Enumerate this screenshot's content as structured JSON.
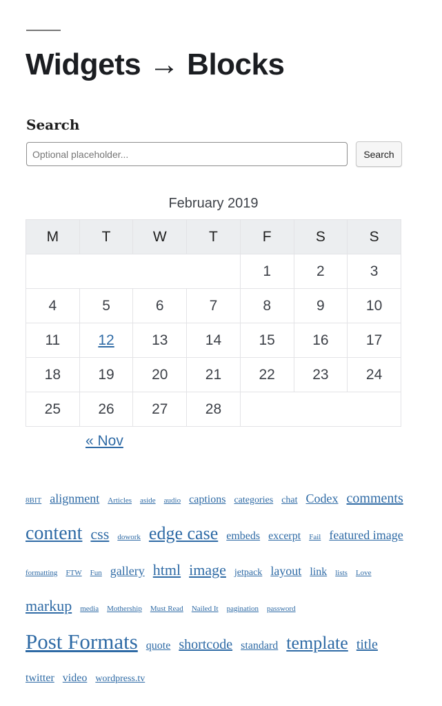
{
  "page": {
    "title": "Widgets → Blocks"
  },
  "search": {
    "label": "Search",
    "placeholder": "Optional placeholder...",
    "value": "",
    "button_label": "Search"
  },
  "calendar": {
    "caption": "February 2019",
    "weekdays": [
      "M",
      "T",
      "W",
      "T",
      "F",
      "S",
      "S"
    ],
    "weeks": [
      [
        "",
        "",
        "",
        "",
        "1",
        "2",
        "3"
      ],
      [
        "4",
        "5",
        "6",
        "7",
        "8",
        "9",
        "10"
      ],
      [
        "11",
        "12",
        "13",
        "14",
        "15",
        "16",
        "17"
      ],
      [
        "18",
        "19",
        "20",
        "21",
        "22",
        "23",
        "24"
      ],
      [
        "25",
        "26",
        "27",
        "28",
        "",
        "",
        ""
      ]
    ],
    "linked_days": [
      "12"
    ],
    "prev_link": "« Nov",
    "link_color": "#2e6aa5"
  },
  "tag_cloud": {
    "tags": [
      {
        "label": "8BIT",
        "weight": 1
      },
      {
        "label": "alignment",
        "weight": 4
      },
      {
        "label": "Articles",
        "weight": 1
      },
      {
        "label": "aside",
        "weight": 1
      },
      {
        "label": "audio",
        "weight": 1
      },
      {
        "label": "captions",
        "weight": 3
      },
      {
        "label": "categories",
        "weight": 2
      },
      {
        "label": "chat",
        "weight": 2
      },
      {
        "label": "Codex",
        "weight": 4
      },
      {
        "label": "comments",
        "weight": 5
      },
      {
        "label": "content",
        "weight": 8
      },
      {
        "label": "css",
        "weight": 6
      },
      {
        "label": "dowork",
        "weight": 1
      },
      {
        "label": "edge case",
        "weight": 7
      },
      {
        "label": "embeds",
        "weight": 3
      },
      {
        "label": "excerpt",
        "weight": 3
      },
      {
        "label": "Fail",
        "weight": 1
      },
      {
        "label": "featured image",
        "weight": 4
      },
      {
        "label": "formatting",
        "weight": 1
      },
      {
        "label": "FTW",
        "weight": 1
      },
      {
        "label": "Fun",
        "weight": 1
      },
      {
        "label": "gallery",
        "weight": 4
      },
      {
        "label": "html",
        "weight": 6
      },
      {
        "label": "image",
        "weight": 6
      },
      {
        "label": "jetpack",
        "weight": 2
      },
      {
        "label": "layout",
        "weight": 4
      },
      {
        "label": "link",
        "weight": 3
      },
      {
        "label": "lists",
        "weight": 1
      },
      {
        "label": "Love",
        "weight": 1
      },
      {
        "label": "markup",
        "weight": 6
      },
      {
        "label": "media",
        "weight": 1
      },
      {
        "label": "Mothership",
        "weight": 1
      },
      {
        "label": "Must Read",
        "weight": 1
      },
      {
        "label": "Nailed It",
        "weight": 1
      },
      {
        "label": "pagination",
        "weight": 1
      },
      {
        "label": "password",
        "weight": 1
      },
      {
        "label": "Post Formats",
        "weight": 9
      },
      {
        "label": "quote",
        "weight": 3
      },
      {
        "label": "shortcode",
        "weight": 5
      },
      {
        "label": "standard",
        "weight": 3
      },
      {
        "label": "template",
        "weight": 7
      },
      {
        "label": "title",
        "weight": 5
      },
      {
        "label": "twitter",
        "weight": 3
      },
      {
        "label": "video",
        "weight": 3
      },
      {
        "label": "wordpress.tv",
        "weight": 2
      }
    ]
  }
}
